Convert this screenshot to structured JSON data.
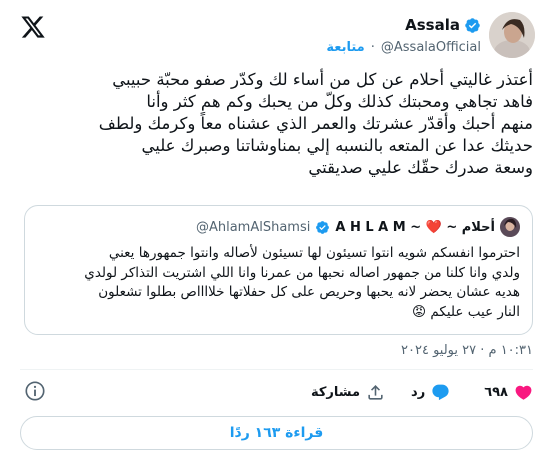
{
  "author": {
    "name": "Assala",
    "handle": "@AssalaOfficial",
    "separator": "·",
    "follow_label": "متابعة"
  },
  "tweet": {
    "text": "أعتذر غاليتي أحلام عن كل من أساء لك وكدّر صفو محبّة حبيبي\nفاهد تجاهي ومحبتك كذلك وكلّ من يحبك وكم هم كثر وأنا\nمنهم أحبك وأقدّر عشرتك والعمر الذي عشناه معاً وكرمك ولطف\nحديثك عدا عن المتعه بالنسبه إلي بمناوشاتنا وصبرك عليي\nوسعة صدرك حقّك عليي صديقتي"
  },
  "quote": {
    "name": "أحلام ~ ❤️ ~ A H L A M",
    "handle": "@AhlamAlShamsi",
    "text": "احترموا انفسكم شويه انتوا تسيئون لها تسيئون لأصاله وانتوا جمهورها يعني\nولدي وانا كلنا من جمهور اصاله نحبها من عمرنا وانا اللي اشتريت التذاكر لولدي\nهديه عشان يحضر لانه يحبها وحريص على كل حفلاتها خلااااص بطلوا تشعلون\nالنار عيب عليكم 😡"
  },
  "timestamp": "١٠:٣١ م · ٢٧ يوليو ٢٠٢٤",
  "actions": {
    "likes": "٦٩٨",
    "reply_label": "رد",
    "share_label": "مشاركة"
  },
  "read_replies_label": "قراءة ١٦٣ ردًا",
  "colors": {
    "accent": "#1d9bf0",
    "like": "#f91880",
    "text": "#0f1419",
    "muted": "#536471"
  },
  "icons": [
    "x-logo-icon",
    "verified-badge-icon",
    "heart-icon",
    "reply-icon",
    "share-icon",
    "info-icon"
  ]
}
